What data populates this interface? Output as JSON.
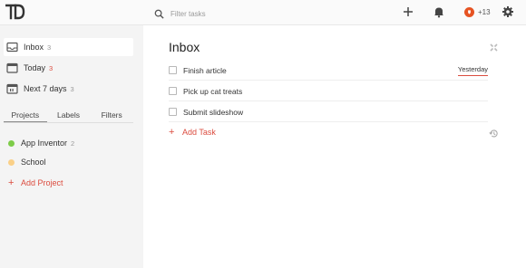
{
  "header": {
    "logo_icon": "todoist-logo-icon",
    "search": {
      "placeholder": "Filter tasks",
      "icon": "search-icon"
    },
    "karma": {
      "label": "+13"
    }
  },
  "sidebar": {
    "nav": [
      {
        "label": "Inbox",
        "count": "3",
        "icon": "inbox-icon",
        "active": true
      },
      {
        "label": "Today",
        "count": "3",
        "icon": "calendar-icon",
        "count_color": "#db4c3f"
      },
      {
        "label": "Next 7 days",
        "count": "3",
        "icon": "calendar-week-icon"
      }
    ],
    "tabs": [
      {
        "label": "Projects",
        "active": true
      },
      {
        "label": "Labels"
      },
      {
        "label": "Filters"
      }
    ],
    "projects": [
      {
        "label": "App Inventor",
        "count": "2",
        "color": "#7ecc49"
      },
      {
        "label": "School",
        "count": "",
        "color": "#fad088"
      }
    ],
    "add_project": "Add Project"
  },
  "main": {
    "title": "Inbox",
    "tasks": [
      {
        "label": "Finish article",
        "due": "Yesterday"
      },
      {
        "label": "Pick up cat treats",
        "due": ""
      },
      {
        "label": "Submit slideshow",
        "due": ""
      }
    ],
    "add_task": "Add Task"
  },
  "colors": {
    "accent": "#db4c3f",
    "karma": "#e65322",
    "sidebar_bg": "#f4f4f4"
  }
}
